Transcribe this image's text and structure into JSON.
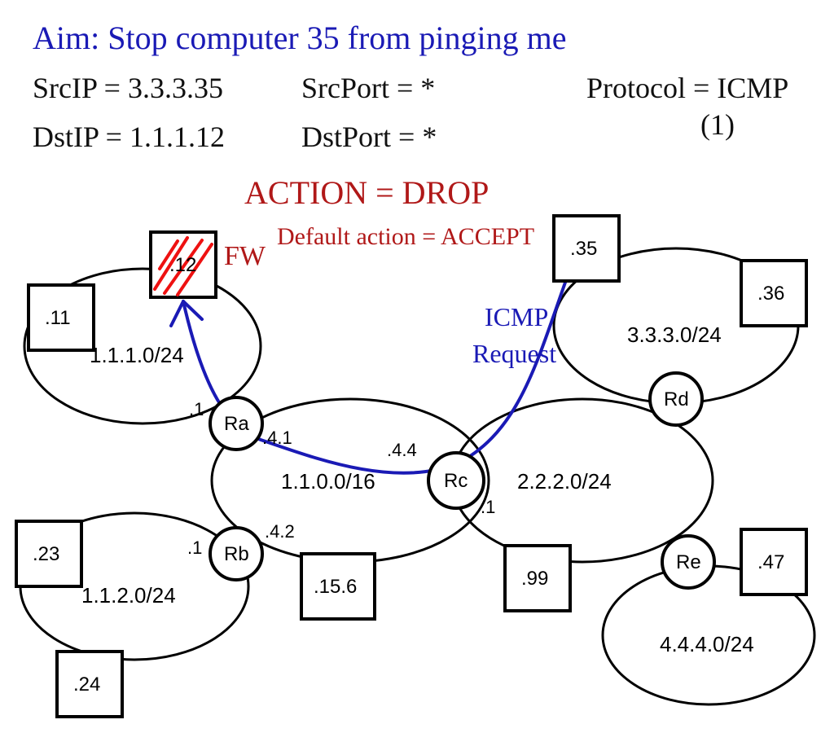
{
  "notes": {
    "aim": "Aim: Stop computer 35 from pinging me",
    "src_ip": "SrcIP = 3.3.3.35",
    "src_port": "SrcPort = *",
    "protocol": "Protocol = ICMP",
    "protocol_num": "(1)",
    "dst_ip": "DstIP = 1.1.1.12",
    "dst_port": "DstPort = *",
    "action": "ACTION = DROP",
    "default_action": "Default action = ACCEPT",
    "fw_label": "FW",
    "icmp_req": "ICMP",
    "icmp_req2": "Request"
  },
  "networks": {
    "net_111": "1.1.1.0/24",
    "net_112": "1.1.2.0/24",
    "net_110_16": "1.1.0.0/16",
    "net_222": "2.2.2.0/24",
    "net_333": "3.3.3.0/24",
    "net_444": "4.4.4.0/24"
  },
  "routers": {
    "ra": "Ra",
    "rb": "Rb",
    "rc": "Rc",
    "rd": "Rd",
    "re": "Re"
  },
  "iface": {
    "ra_left": ".1",
    "ra_right": ".4.1",
    "rb_left": ".1",
    "rb_right": ".4.2",
    "rc_top": ".4.4",
    "rc_right": ".1"
  },
  "hosts": {
    "h11": ".11",
    "h12": ".12",
    "h23": ".23",
    "h24": ".24",
    "h156": ".15.6",
    "h99": ".99",
    "h35": ".35",
    "h36": ".36",
    "h47": ".47"
  }
}
